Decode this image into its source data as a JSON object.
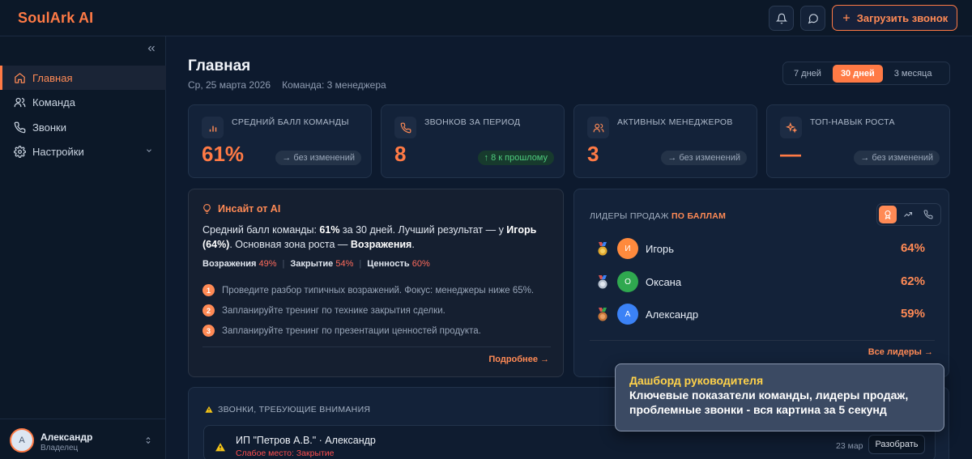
{
  "app": {
    "logo": "SoulArk AI"
  },
  "topbar": {
    "upload_label": "Загрузить звонок"
  },
  "sidebar": {
    "items": [
      {
        "label": "Главная",
        "icon": "home-icon"
      },
      {
        "label": "Команда",
        "icon": "users-icon"
      },
      {
        "label": "Звонки",
        "icon": "phone-icon"
      },
      {
        "label": "Настройки",
        "icon": "gear-icon"
      }
    ],
    "user": {
      "initial": "А",
      "name": "Александр",
      "role": "Владелец"
    }
  },
  "header": {
    "title": "Главная",
    "date": "Ср, 25 марта 2026",
    "team": "Команда: 3 менеджера",
    "periods": [
      "7 дней",
      "30 дней",
      "3 месяца"
    ],
    "selected_period": "30 дней"
  },
  "stats": [
    {
      "label": "СРЕДНИЙ БАЛЛ КОМАНДЫ",
      "value": "61%",
      "delta": "→ без изменений",
      "icon": "bar-chart-icon"
    },
    {
      "label": "ЗВОНКОВ ЗА ПЕРИОД",
      "value": "8",
      "delta": "↑ 8 к прошлому",
      "icon": "phone-icon"
    },
    {
      "label": "АКТИВНЫХ МЕНЕДЖЕРОВ",
      "value": "3",
      "delta": "→ без изменений",
      "icon": "users-icon"
    },
    {
      "label": "ТОП-НАВЫК РОСТА",
      "value": "—",
      "delta": "→ без изменений",
      "icon": "sparkle-icon"
    }
  ],
  "insight": {
    "title": "Инсайт от AI",
    "t1": "Средний балл команды: ",
    "b1": "61%",
    "t2": " за 30 дней. Лучший результат — у ",
    "b2": "Игорь (64%)",
    "t3": ". Основная зона роста — ",
    "b3": "Возражения",
    "t4": ".",
    "skills": [
      {
        "name": "Возражения",
        "pct": "49%"
      },
      {
        "name": "Закрытие",
        "pct": "54%"
      },
      {
        "name": "Ценность",
        "pct": "60%"
      }
    ],
    "steps": [
      {
        "num": "1",
        "text": "Проведите разбор типичных возражений. Фокус: менеджеры ниже 65%."
      },
      {
        "num": "2",
        "text": "Запланируйте тренинг по технике закрытия сделки."
      },
      {
        "num": "3",
        "text": "Запланируйте тренинг по презентации ценностей продукта."
      }
    ],
    "more": "Подробнее →"
  },
  "leaders": {
    "heading": "ЛИДЕРЫ ПРОДАЖ",
    "heading_accent": "ПО БАЛЛАМ",
    "rows": [
      {
        "initial": "И",
        "name": "Игорь",
        "score": "64%",
        "color": "#ff8a3d",
        "medal": "#e0a82e"
      },
      {
        "initial": "О",
        "name": "Оксана",
        "score": "62%",
        "color": "#2fa84f",
        "medal": "#b8c2cf"
      },
      {
        "initial": "А",
        "name": "Александр",
        "score": "59%",
        "color": "#3b82f6",
        "medal": "#c8783a"
      }
    ],
    "all": "Все лидеры →"
  },
  "attention": {
    "title": "ЗВОНКИ, ТРЕБУЮЩИЕ ВНИМАНИЯ",
    "call": {
      "name": "ИП \"Петров А.В.\" · Александр",
      "weak": "Слабое место: Закрытие",
      "date": "23 мар",
      "button": "Разобрать"
    }
  },
  "tooltip": {
    "title": "Дашборд руководителя",
    "text": "Ключевые показатели команды, лидеры продаж, проблемные звонки - вся картина за 5 секунд"
  },
  "colors": {
    "accent": "#ff7a45",
    "background": "#0d1a2e",
    "card": "#132239"
  }
}
